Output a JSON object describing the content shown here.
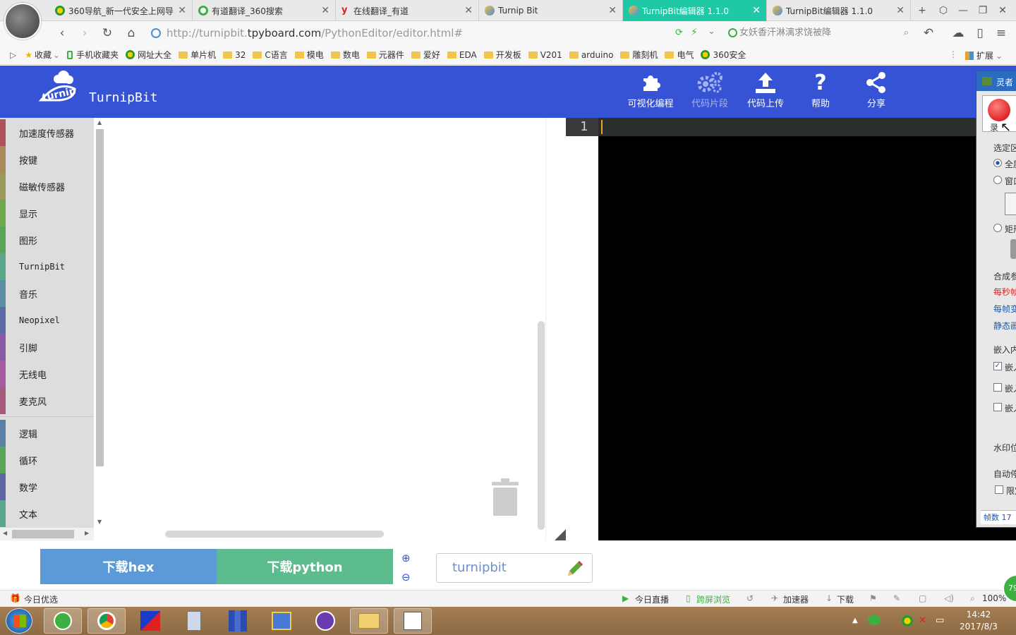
{
  "browser": {
    "tabs": [
      {
        "title": "360导航_新一代安全上网导",
        "icon": "360-nav-icon",
        "active": false
      },
      {
        "title": "有道翻译_360搜索",
        "icon": "360-search-icon",
        "active": false
      },
      {
        "title": "在线翻译_有道",
        "icon": "youdao-icon",
        "active": false
      },
      {
        "title": "Turnip Bit",
        "icon": "turnipbit-icon",
        "active": false
      },
      {
        "title": "TurnipBit编辑器 1.1.0",
        "icon": "turnipbit-icon",
        "active": true
      },
      {
        "title": "TurnipBit编辑器 1.1.0",
        "icon": "turnipbit-icon",
        "active": false
      }
    ],
    "url_prefix": "http://turnipbit.",
    "url_domain": "tpyboard.com",
    "url_path": "/PythonEditor/editor.html#",
    "search_placeholder": "女妖香汗淋漓求饶被降",
    "bookmarks": [
      {
        "label": "收藏",
        "icon": "star-icon"
      },
      {
        "label": "手机收藏夹",
        "icon": "phone-icon"
      },
      {
        "label": "网址大全",
        "icon": "360-icon"
      },
      {
        "label": "单片机",
        "icon": "folder-icon"
      },
      {
        "label": "32",
        "icon": "folder-icon"
      },
      {
        "label": "C语言",
        "icon": "folder-icon"
      },
      {
        "label": "模电",
        "icon": "folder-icon"
      },
      {
        "label": "数电",
        "icon": "folder-icon"
      },
      {
        "label": "元器件",
        "icon": "folder-icon"
      },
      {
        "label": "爱好",
        "icon": "folder-icon"
      },
      {
        "label": "EDA",
        "icon": "folder-icon"
      },
      {
        "label": "开发板",
        "icon": "folder-icon"
      },
      {
        "label": "V201",
        "icon": "folder-icon"
      },
      {
        "label": "arduino",
        "icon": "folder-icon"
      },
      {
        "label": "雕刻机",
        "icon": "folder-icon"
      },
      {
        "label": "电气",
        "icon": "folder-icon"
      },
      {
        "label": "360安全",
        "icon": "360-icon"
      }
    ],
    "extensions_label": "扩展"
  },
  "app": {
    "title": "TurnipBit",
    "header_buttons": [
      {
        "label": "可视化编程",
        "icon": "puzzle-icon",
        "dim": false
      },
      {
        "label": "代码片段",
        "icon": "gears-icon",
        "dim": true
      },
      {
        "label": "代码上传",
        "icon": "upload-icon",
        "dim": false
      },
      {
        "label": "帮助",
        "icon": "help-icon",
        "dim": false
      },
      {
        "label": "分享",
        "icon": "share-icon",
        "dim": false
      }
    ],
    "categories": [
      {
        "label": "加速度传感器",
        "color": "#b0545a"
      },
      {
        "label": "按键",
        "color": "#a98a5b"
      },
      {
        "label": "磁敏传感器",
        "color": "#9a9a5b"
      },
      {
        "label": "显示",
        "color": "#6fa84e"
      },
      {
        "label": "图形",
        "color": "#5ba55b"
      },
      {
        "label": "TurnipBit",
        "color": "#5ba58a"
      },
      {
        "label": "音乐",
        "color": "#5b8fa5"
      },
      {
        "label": "Neopixel",
        "color": "#5b6ba5"
      },
      {
        "label": "引脚",
        "color": "#8a5ba5"
      },
      {
        "label": "无线电",
        "color": "#a55ba0"
      },
      {
        "label": "麦克风",
        "color": "#a55b7a"
      },
      {
        "label": "逻辑",
        "color": "#5b80a5"
      },
      {
        "label": "循环",
        "color": "#5ba55b"
      },
      {
        "label": "数学",
        "color": "#5b67a5"
      },
      {
        "label": "文本",
        "color": "#5ba58c"
      }
    ],
    "editor_line_number": "1",
    "download_hex_label": "下载hex",
    "download_python_label": "下载python",
    "project_name": "turnipbit"
  },
  "status_bar": {
    "left_label": "今日优选",
    "items": [
      "今日直播",
      "跨屏浏览",
      "加速器",
      "下载"
    ],
    "zoom": "100%"
  },
  "taskbar": {
    "time": "14:42",
    "date": "2017/8/3"
  },
  "recorder_panel": {
    "title": "灵者",
    "record_label": "录",
    "texts": [
      "选定区",
      "全屏",
      "窗口",
      "矩形",
      "合成参",
      "每秒帧",
      "每帧变",
      "静态画",
      "嵌入内",
      "嵌入",
      "嵌入",
      "嵌入",
      "水印位",
      "自动停",
      "限定",
      "帧数 17"
    ]
  }
}
